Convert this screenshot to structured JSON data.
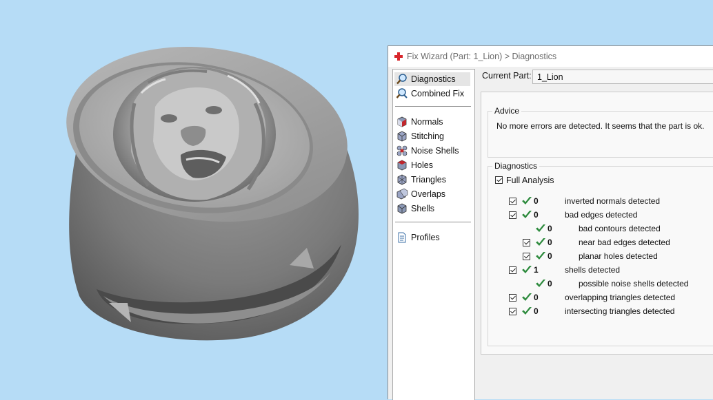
{
  "window": {
    "title": "Fix Wizard (Part: 1_Lion) > Diagnostics",
    "accent_color": "#d8262c"
  },
  "nav": {
    "items_top": [
      {
        "label": "Diagnostics",
        "icon": "magnifier-icon"
      },
      {
        "label": "Combined Fix",
        "icon": "wand-icon"
      }
    ],
    "items_tools": [
      {
        "label": "Normals",
        "icon": "normals-cube-icon"
      },
      {
        "label": "Stitching",
        "icon": "stitching-cube-icon"
      },
      {
        "label": "Noise Shells",
        "icon": "noise-shells-icon"
      },
      {
        "label": "Holes",
        "icon": "holes-cube-icon"
      },
      {
        "label": "Triangles",
        "icon": "triangles-cube-icon"
      },
      {
        "label": "Overlaps",
        "icon": "overlaps-cube-icon"
      },
      {
        "label": "Shells",
        "icon": "shells-cube-icon"
      }
    ],
    "items_bottom": [
      {
        "label": "Profiles",
        "icon": "document-icon"
      }
    ],
    "selected": "Diagnostics"
  },
  "current_part": {
    "label": "Current Part:",
    "value": "1_Lion"
  },
  "advice": {
    "title": "Advice",
    "text": "No more errors are detected. It seems that the part is ok."
  },
  "diagnostics": {
    "title": "Diagnostics",
    "full_analysis_label": "Full Analysis",
    "full_analysis_checked": true,
    "rows": [
      {
        "count": "0",
        "label": "inverted normals detected",
        "checked": true,
        "indent": 0
      },
      {
        "count": "0",
        "label": "bad edges detected",
        "checked": true,
        "indent": 0
      },
      {
        "count": "0",
        "label": "bad contours detected",
        "checked": false,
        "indent": 1
      },
      {
        "count": "0",
        "label": "near bad edges detected",
        "checked": true,
        "indent": 1
      },
      {
        "count": "0",
        "label": "planar holes detected",
        "checked": true,
        "indent": 1
      },
      {
        "count": "1",
        "label": "shells detected",
        "checked": true,
        "indent": 0
      },
      {
        "count": "0",
        "label": "possible noise shells detected",
        "checked": false,
        "indent": 1
      },
      {
        "count": "0",
        "label": "overlapping triangles detected",
        "checked": true,
        "indent": 0
      },
      {
        "count": "0",
        "label": "intersecting triangles detected",
        "checked": true,
        "indent": 0
      }
    ],
    "ok_color": "#2e8b3e"
  }
}
